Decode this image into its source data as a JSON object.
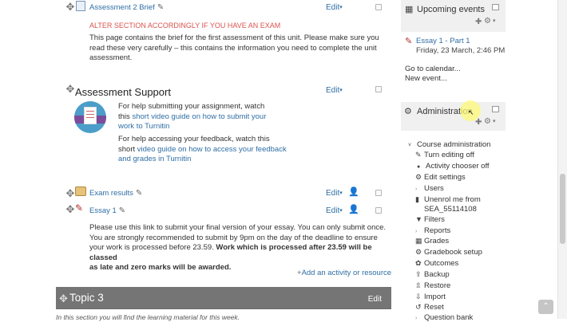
{
  "assessment_brief": {
    "title": "Assessment 2 Brief",
    "edit_label": "Edit",
    "alter_notice": "ALTER SECTION ACCORDINGLY IF YOU HAVE AN EXAM",
    "description_lines": [
      "This page contains the brief for the first assessment of this unit. Please make sure you",
      "read these very carefully – this contains the information you need to complete the unit",
      "assessment."
    ]
  },
  "assessment_support": {
    "heading": "Assessment Support",
    "edit_label": "Edit",
    "p1_line1": "For help submitting your assignment, watch",
    "p1_line2_prefix": "this ",
    "p1_link1": "short video guide on how to submit your",
    "p1_link2": "work to Turnitin",
    "p2_line1": "For help accessing your feedback, watch this",
    "p2_line2_prefix": "short ",
    "p2_link1": "video guide on how to access your feedback",
    "p2_link2": "and grades in Turnitin"
  },
  "activities": [
    {
      "title": "Exam results",
      "edit_label": "Edit"
    },
    {
      "title": "Essay 1",
      "edit_label": "Edit"
    }
  ],
  "essay_desc": {
    "lines": [
      "Please use this link to submit your final version of your essay. You can only submit once.",
      "You are strongly recommended to submit by 9pm on the day of the deadline to ensure",
      "your work is processed before 23.59. "
    ],
    "bold1": "Work which is processed after 23.59 will be classed",
    "bold2": "as late and zero marks will be awarded."
  },
  "add_activity": "Add an activity or resource",
  "topic3": {
    "title": "Topic 3",
    "edit_label": "Edit"
  },
  "topic3_intro": "In this section you will find the learning material for this week.",
  "upcoming": {
    "title": "Upcoming events",
    "event_name": "Essay 1 - Part 1",
    "event_date": "Friday, 23 March, 2:46 PM",
    "goto_calendar": "Go to calendar...",
    "new_event": "New event..."
  },
  "administration": {
    "title": "Administration",
    "items": [
      {
        "label": "Course administration",
        "icon": "caret-down-icon"
      },
      {
        "label": "Turn editing off",
        "icon": "pencil-icon"
      },
      {
        "label": "Activity chooser off",
        "icon": "bullet-icon"
      },
      {
        "label": "Edit settings",
        "icon": "gear-icon"
      },
      {
        "label": "Users",
        "icon": "caret-right-icon"
      },
      {
        "label": "Unenrol me from",
        "icon": "user-remove-icon"
      },
      {
        "label": "SEA_55114108",
        "icon": ""
      },
      {
        "label": "Filters",
        "icon": "filter-icon"
      },
      {
        "label": "Reports",
        "icon": "caret-right-icon"
      },
      {
        "label": "Grades",
        "icon": "grades-icon"
      },
      {
        "label": "Gradebook setup",
        "icon": "gear-icon"
      },
      {
        "label": "Outcomes",
        "icon": "outcomes-icon"
      },
      {
        "label": "Backup",
        "icon": "backup-icon"
      },
      {
        "label": "Restore",
        "icon": "restore-icon"
      },
      {
        "label": "Import",
        "icon": "import-icon"
      },
      {
        "label": "Reset",
        "icon": "reset-icon"
      },
      {
        "label": "Question bank",
        "icon": "caret-right-icon"
      }
    ]
  }
}
